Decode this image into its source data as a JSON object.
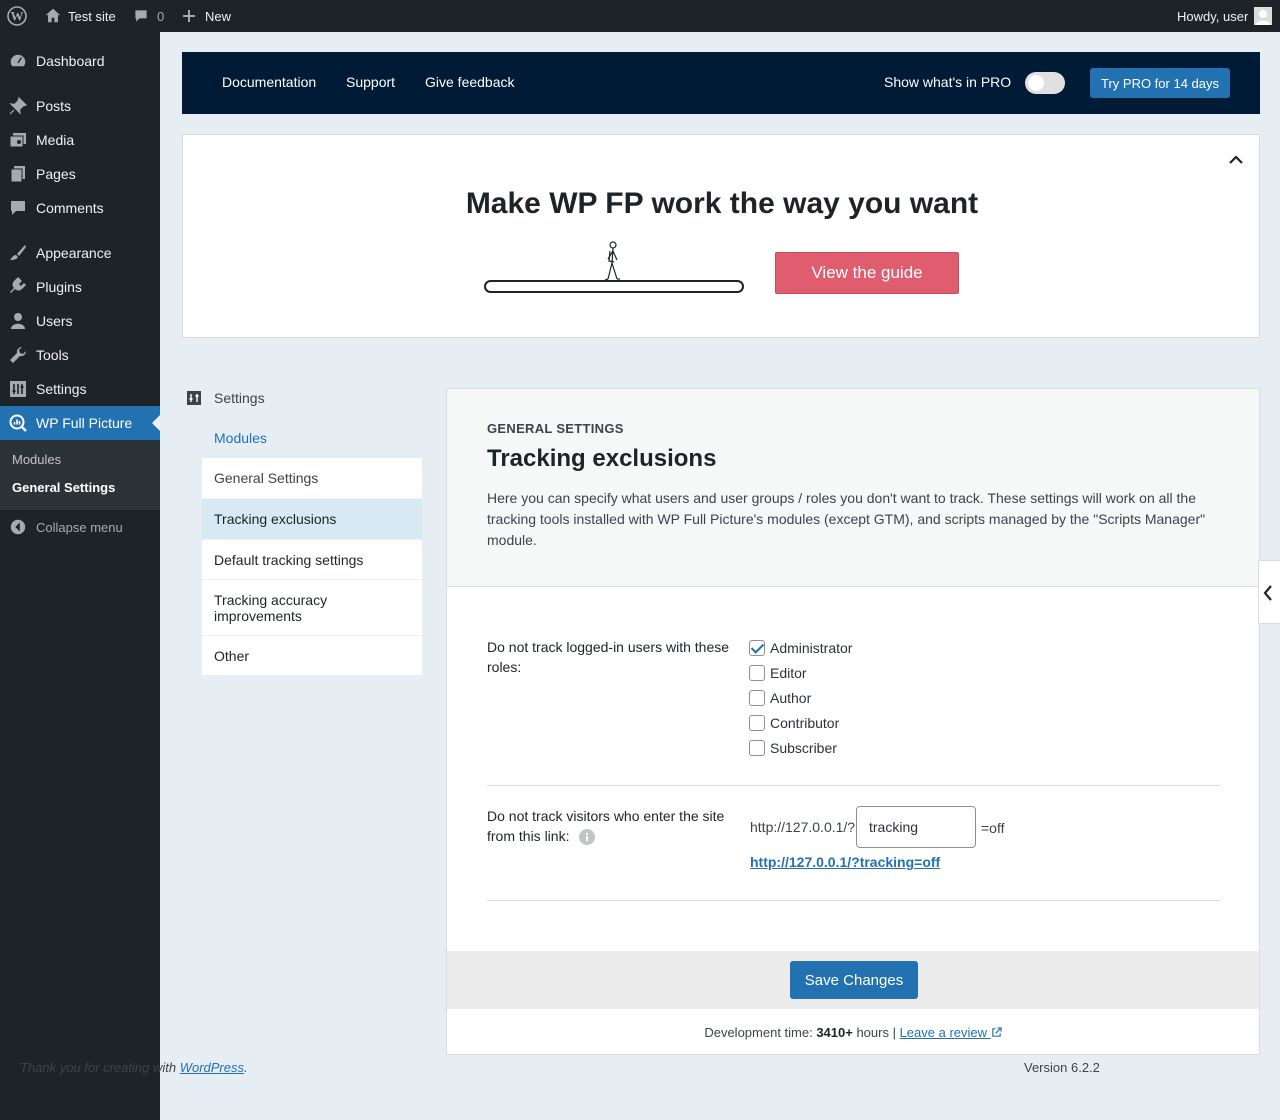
{
  "admin_bar": {
    "site_name": "Test site",
    "comments_count": "0",
    "new_label": "New",
    "howdy": "Howdy, user"
  },
  "menu": {
    "items": [
      {
        "label": "Dashboard",
        "icon": "dashboard-icon"
      },
      {
        "label": "Posts",
        "icon": "pin-icon"
      },
      {
        "label": "Media",
        "icon": "media-icon"
      },
      {
        "label": "Pages",
        "icon": "page-icon"
      },
      {
        "label": "Comments",
        "icon": "comment-icon"
      },
      {
        "label": "Appearance",
        "icon": "brush-icon"
      },
      {
        "label": "Plugins",
        "icon": "plug-icon"
      },
      {
        "label": "Users",
        "icon": "user-icon"
      },
      {
        "label": "Tools",
        "icon": "wrench-icon"
      },
      {
        "label": "Settings",
        "icon": "sliders-icon"
      },
      {
        "label": "WP Full Picture",
        "icon": "chart-magnifier-icon"
      }
    ],
    "submenu": [
      "Modules",
      "General Settings"
    ],
    "collapse": "Collapse menu"
  },
  "topnav": {
    "links": [
      "Documentation",
      "Support",
      "Give feedback"
    ],
    "pro_label": "Show what's in PRO",
    "pro_toggle_on": false,
    "pro_button": "Try PRO for 14 days"
  },
  "hero": {
    "title": "Make WP FP work the way you want",
    "guide_button": "View the guide"
  },
  "settings_nav": {
    "title": "Settings",
    "modules_link": "Modules",
    "items": [
      "General Settings",
      "Tracking exclusions",
      "Default tracking settings",
      "Tracking accuracy improvements",
      "Other"
    ],
    "active": "Tracking exclusions"
  },
  "section": {
    "eyebrow": "GENERAL SETTINGS",
    "title": "Tracking exclusions",
    "description": "Here you can specify what users and user groups / roles you don't want to track. These settings will work on all the tracking tools installed with WP Full Picture's modules (except GTM), and scripts managed by the \"Scripts Manager\" module."
  },
  "roles_field": {
    "label": "Do not track logged-in users with these roles:",
    "roles": [
      {
        "name": "Administrator",
        "checked": true
      },
      {
        "name": "Editor",
        "checked": false
      },
      {
        "name": "Author",
        "checked": false
      },
      {
        "name": "Contributor",
        "checked": false
      },
      {
        "name": "Subscriber",
        "checked": false
      }
    ]
  },
  "link_field": {
    "label": "Do not track visitors who enter the site from this link:",
    "prefix": "http://127.0.0.1/?",
    "param_value": "tracking",
    "suffix": "=off",
    "full_link": "http://127.0.0.1/?tracking=off"
  },
  "save_button": "Save Changes",
  "devtime": {
    "prefix": "Development time: ",
    "hours": "3410+",
    "suffix": " hours | ",
    "review_link": "Leave a review"
  },
  "footer": {
    "thanks_prefix": "Thank you for creating with ",
    "wp_link": "WordPress",
    "thanks_suffix": ".",
    "version": "Version 6.2.2"
  },
  "colors": {
    "admin_dark": "#1d2327",
    "accent_blue": "#2271b1",
    "topnav_navy": "#011a36",
    "guide_button": "#e05d6f",
    "active_nav": "#d7eaf3"
  }
}
